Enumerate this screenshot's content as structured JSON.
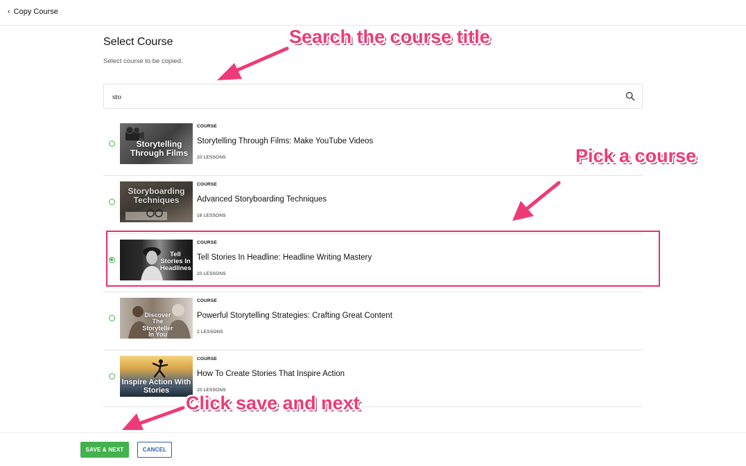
{
  "header": {
    "back_label": "Copy Course"
  },
  "page": {
    "title": "Select Course",
    "subtitle": "Select course to be copied."
  },
  "search": {
    "value": "sto"
  },
  "courses": [
    {
      "kicker": "COURSE",
      "title": "Storytelling Through Films: Make YouTube Videos",
      "lessons": "20 LESSONS",
      "thumb_text": "Storytelling Through Films",
      "selected": false
    },
    {
      "kicker": "COURSE",
      "title": "Advanced Storyboarding Techniques",
      "lessons": "18 LESSONS",
      "thumb_text": "Storyboarding Techniques",
      "selected": false
    },
    {
      "kicker": "COURSE",
      "title": "Tell Stories In Headline: Headline Writing Mastery",
      "lessons": "20 LESSONS",
      "thumb_text": "Tell Stories In Headlines",
      "selected": true
    },
    {
      "kicker": "COURSE",
      "title": "Powerful Storytelling Strategies: Crafting Great Content",
      "lessons": "2 LESSONS",
      "thumb_text": "Discover The Storyteller In You",
      "selected": false
    },
    {
      "kicker": "COURSE",
      "title": "How To Create Stories That Inspire Action",
      "lessons": "20 LESSONS",
      "thumb_text": "Inspire Action With Stories",
      "selected": false
    }
  ],
  "footer": {
    "save_label": "SAVE & NEXT",
    "cancel_label": "CANCEL"
  },
  "annotations": {
    "search_hint": "Search the course title",
    "pick_hint": "Pick a course",
    "save_hint": "Click save and next"
  },
  "colors": {
    "accent_green": "#43b14d",
    "cancel_blue": "#2f5bb7",
    "annotation_pink": "#ee3b77"
  }
}
